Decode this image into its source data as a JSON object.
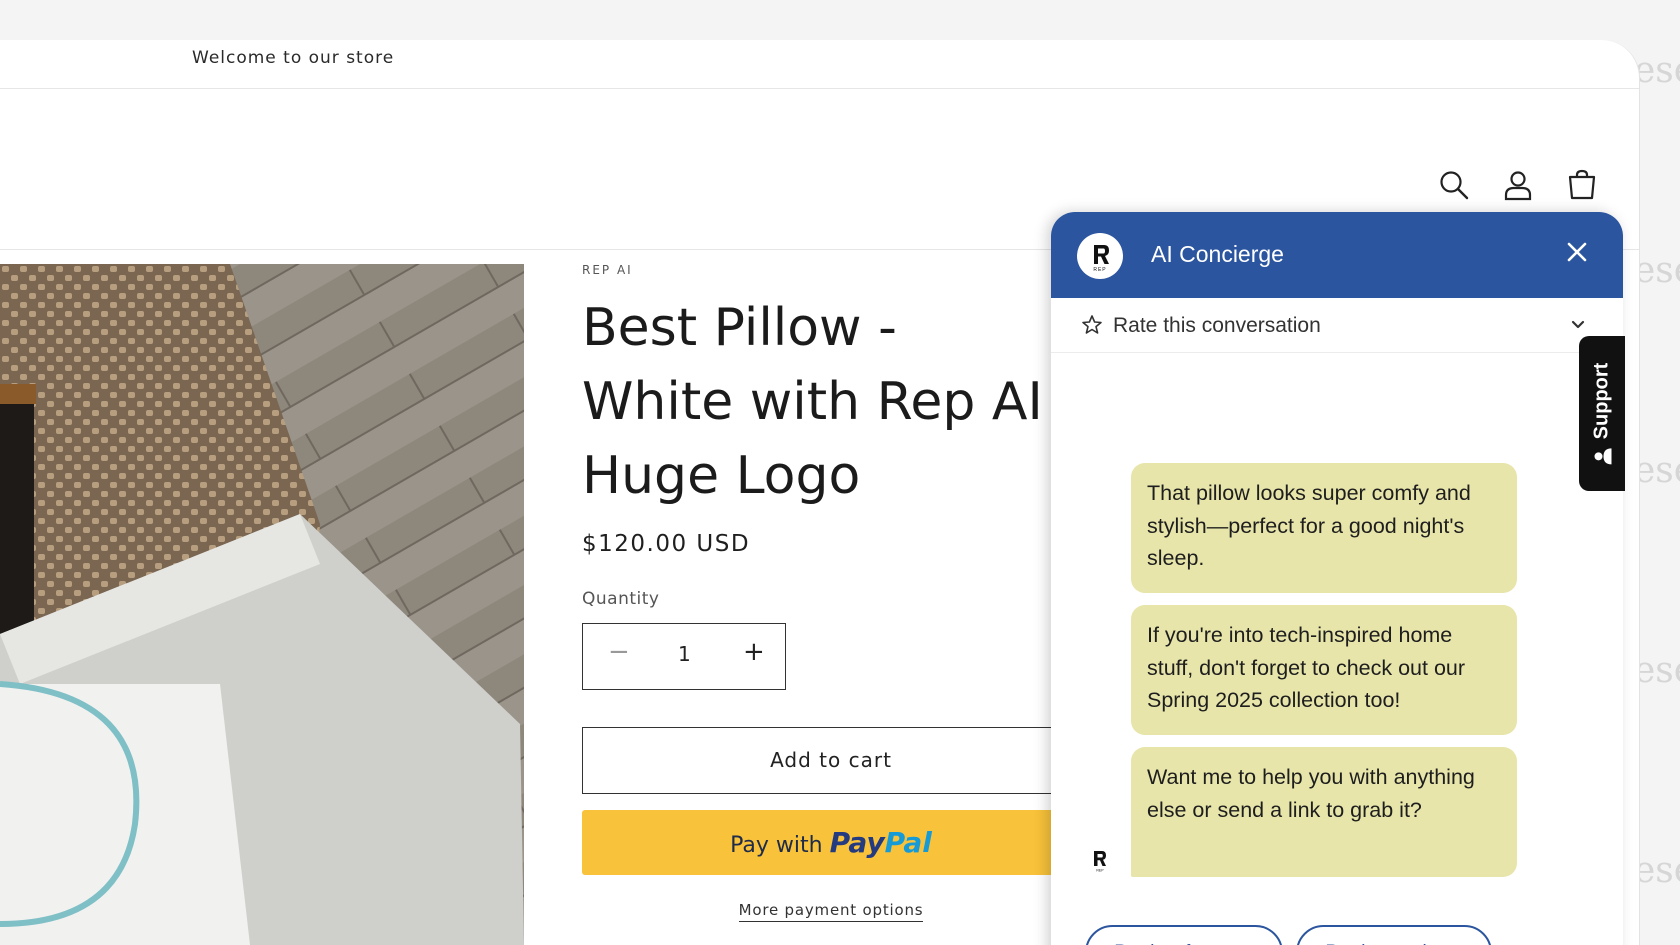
{
  "announcement": "Welcome to our store",
  "header": {
    "icons": [
      "search-icon",
      "account-icon",
      "cart-icon"
    ]
  },
  "product": {
    "vendor": "REP AI",
    "title": "Best Pillow - White with Rep AI Huge Logo",
    "price": "$120.00 USD",
    "quantity_label": "Quantity",
    "quantity_value": "1",
    "minus": "−",
    "plus": "+",
    "add_to_cart": "Add to cart",
    "paypal_prefix": "Pay with",
    "paypal_pay": "Pay",
    "paypal_pal": "Pal",
    "more_payment": "More payment options"
  },
  "support_tab": {
    "label": "Support"
  },
  "chat": {
    "title": "AI Concierge",
    "rate_label": "Rate this conversation",
    "messages": [
      "That pillow looks super comfy and stylish—perfect for a good night's sleep.",
      "If you're into tech-inspired home stuff, don't forget to check out our Spring 2025 collection too!",
      "Want me to help you with anything else or send a link to grab it?"
    ],
    "quick_replies": [
      "Product features",
      "Product variants"
    ],
    "colors": {
      "header": "#2b559f",
      "bubble": "#e7e5aa"
    }
  },
  "watermark": "ese"
}
